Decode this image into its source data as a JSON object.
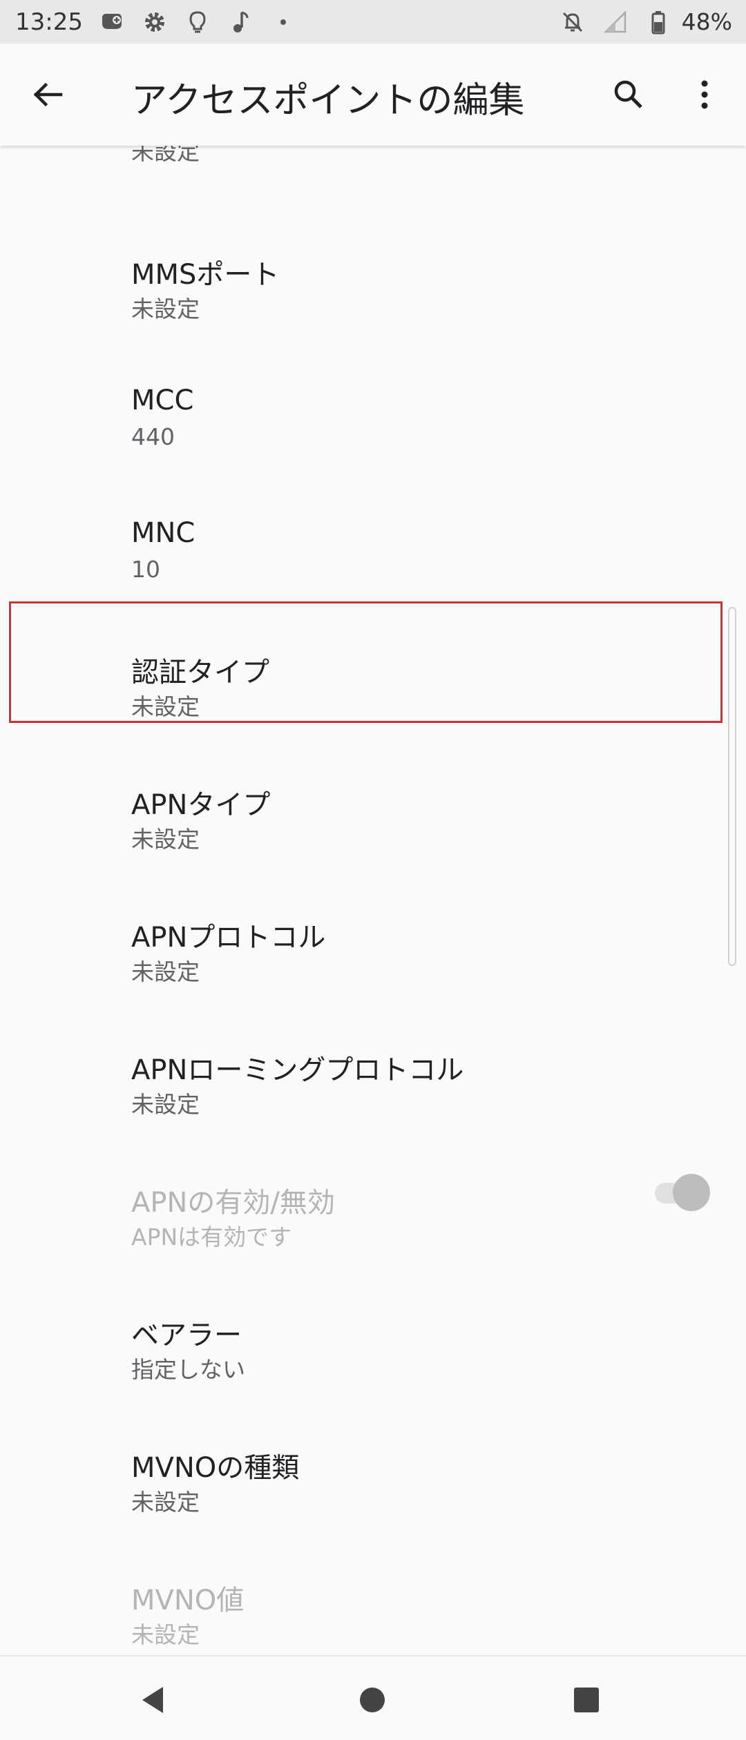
{
  "status_bar": {
    "time": "13:25",
    "battery_percent": "48%",
    "left_icons": [
      "game-controller-icon",
      "settings-gear-icon",
      "lightbulb-icon",
      "music-note-icon",
      "dot-icon"
    ],
    "right_icons": [
      "notifications-off-icon",
      "signal-icon",
      "battery-icon"
    ]
  },
  "app_bar": {
    "title": "アクセスポイントの編集",
    "icons": [
      "back-arrow-icon",
      "search-icon",
      "more-vert-icon"
    ]
  },
  "list": {
    "partial_top_summary": "未設定",
    "items": [
      {
        "title": "MMSポート",
        "summary": "未設定",
        "enabled": true
      },
      {
        "title": "MCC",
        "summary": "440",
        "enabled": true
      },
      {
        "title": "MNC",
        "summary": "10",
        "enabled": true
      },
      {
        "title": "認証タイプ",
        "summary": "未設定",
        "enabled": true,
        "highlighted": true
      },
      {
        "title": "APNタイプ",
        "summary": "未設定",
        "enabled": true
      },
      {
        "title": "APNプロトコル",
        "summary": "未設定",
        "enabled": true
      },
      {
        "title": "APNローミングプロトコル",
        "summary": "未設定",
        "enabled": true
      },
      {
        "title": "APNの有効/無効",
        "summary": "APNは有効です",
        "enabled": false,
        "toggle_on": true
      },
      {
        "title": "ベアラー",
        "summary": "指定しない",
        "enabled": true
      },
      {
        "title": "MVNOの種類",
        "summary": "未設定",
        "enabled": true
      },
      {
        "title": "MVNO値",
        "summary": "未設定",
        "enabled": false
      }
    ]
  },
  "colors": {
    "highlight_border": "#d32f2f",
    "background": "#fafafa",
    "status_bar_bg": "#e8e8e8",
    "disabled_text": "#b4b4b4"
  },
  "nav_bar": {
    "icons": [
      "nav-back-icon",
      "nav-home-icon",
      "nav-recents-icon"
    ]
  }
}
